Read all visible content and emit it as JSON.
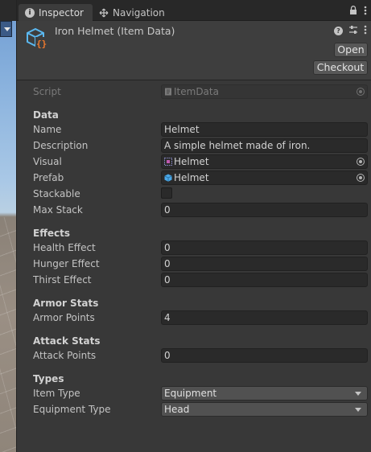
{
  "tabs": [
    {
      "label": "Inspector",
      "icon": "info-icon"
    },
    {
      "label": "Navigation",
      "icon": "navigation-icon"
    }
  ],
  "tab_actions": {
    "lock": "lock-icon",
    "menu": "kebab-menu-icon"
  },
  "header": {
    "title": "Iron Helmet (Item Data)",
    "icon": "scriptable-object-icon",
    "icons": [
      "help-icon",
      "preset-icon",
      "kebab-menu-icon"
    ],
    "open_label": "Open",
    "checkout_label": "Checkout"
  },
  "script": {
    "label": "Script",
    "value": "ItemData"
  },
  "sections": {
    "data": "Data",
    "effects": "Effects",
    "armor": "Armor Stats",
    "attack": "Attack Stats",
    "types": "Types"
  },
  "fields": {
    "name": {
      "label": "Name",
      "value": "Helmet"
    },
    "description": {
      "label": "Description",
      "value": "A simple helmet made of iron."
    },
    "visual": {
      "label": "Visual",
      "value": "Helmet"
    },
    "prefab": {
      "label": "Prefab",
      "value": "Helmet"
    },
    "stackable": {
      "label": "Stackable",
      "checked": false
    },
    "max_stack": {
      "label": "Max Stack",
      "value": "0"
    },
    "health_effect": {
      "label": "Health Effect",
      "value": "0"
    },
    "hunger_effect": {
      "label": "Hunger Effect",
      "value": "0"
    },
    "thirst_effect": {
      "label": "Thirst Effect",
      "value": "0"
    },
    "armor_points": {
      "label": "Armor Points",
      "value": "4"
    },
    "attack_points": {
      "label": "Attack Points",
      "value": "0"
    },
    "item_type": {
      "label": "Item Type",
      "value": "Equipment"
    },
    "equipment_type": {
      "label": "Equipment Type",
      "value": "Head"
    }
  },
  "colors": {
    "panel_bg": "#383838",
    "field_bg": "#2a2a2a",
    "icon_blue": "#5bb8f0",
    "icon_orange": "#f07a2e"
  }
}
